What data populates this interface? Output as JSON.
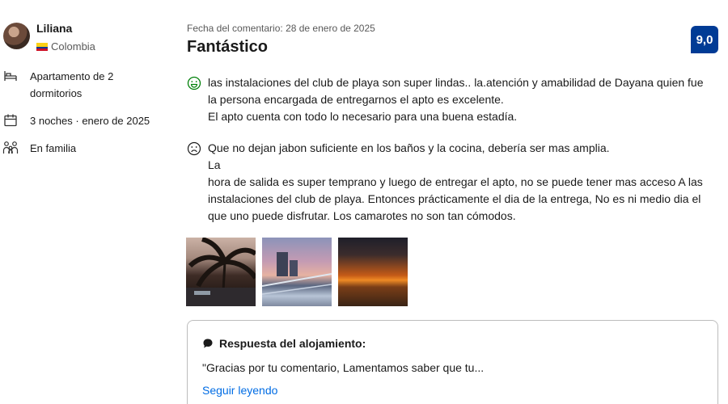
{
  "reviewer": {
    "name": "Liliana",
    "country": "Colombia"
  },
  "stay": {
    "room": "Apartamento de 2 dormitorios",
    "nights": "3 noches · enero de 2025",
    "traveler_type": "En familia"
  },
  "review": {
    "date": "Fecha del comentario: 28 de enero de 2025",
    "title": "Fantástico",
    "score": "9,0",
    "positive": "las instalaciones del club de playa son super lindas.. la.atención y amabilidad de Dayana quien fue la persona encargada de entregarnos el apto es excelente.\nEl apto cuenta con todo lo necesario para una buena estadía.",
    "negative": "Que no dejan jabon suficiente en los baños y la cocina, debería ser mas amplia.\nLa\nhora de salida es super temprano y luego de entregar el apto, no se puede tener mas acceso A las instalaciones del club de playa. Entonces prácticamente el dia de la entrega, No es ni medio dia el que uno puede disfrutar. Los camarotes no son tan cómodos."
  },
  "reply": {
    "heading": "Respuesta del alojamiento:",
    "text": "\"Gracias por tu comentario, Lamentamos saber que tu...",
    "link": "Seguir leyendo"
  },
  "colors": {
    "score_bg": "#003b95",
    "link": "#006ce4",
    "positive_icon": "#008009",
    "negative_icon": "#1a1a1a"
  },
  "icons": [
    "bed-icon",
    "calendar-icon",
    "family-icon",
    "smile-icon",
    "frown-icon",
    "speech-bubble-icon"
  ]
}
